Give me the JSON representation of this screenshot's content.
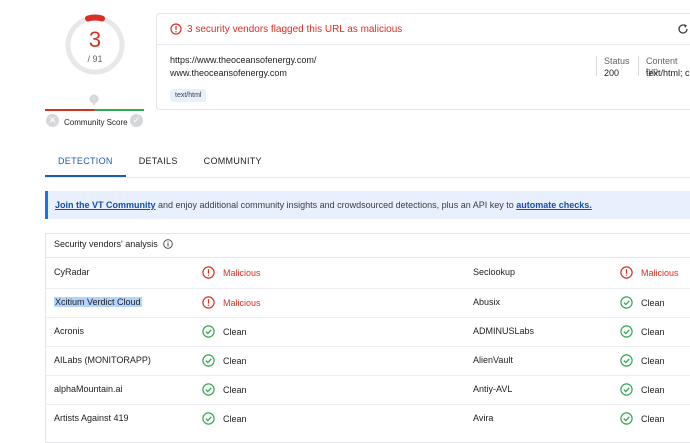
{
  "score": {
    "detections": "3",
    "total": "/ 91",
    "ring_color": "#d93025"
  },
  "community": {
    "label": "Community Score"
  },
  "header": {
    "flag_text": "3 security vendors flagged this URL as malicious",
    "url_full": "https://www.theoceansofenergy.com/",
    "domain": "www.theoceansofenergy.com",
    "status_label": "Status",
    "status_value": "200",
    "content_type_label": "Content typ",
    "content_type_value": "text/html; c",
    "tag": "text/html"
  },
  "tabs": [
    "DETECTION",
    "DETAILS",
    "COMMUNITY"
  ],
  "banner": {
    "link1": "Join the VT Community",
    "middle": " and enjoy additional community insights and crowdsourced detections, plus an API key to ",
    "link2": "automate checks."
  },
  "analysis": {
    "title": "Security vendors' analysis",
    "rows": [
      {
        "left_vendor": "CyRadar",
        "left_result": "Malicious",
        "right_vendor": "Seclookup",
        "right_result": "Malicious"
      },
      {
        "left_vendor": "Xcitium Verdict Cloud",
        "left_result": "Malicious",
        "right_vendor": "Abusix",
        "right_result": "Clean"
      },
      {
        "left_vendor": "Acronis",
        "left_result": "Clean",
        "right_vendor": "ADMINUSLabs",
        "right_result": "Clean"
      },
      {
        "left_vendor": "AILabs (MONITORAPP)",
        "left_result": "Clean",
        "right_vendor": "AlienVault",
        "right_result": "Clean"
      },
      {
        "left_vendor": "alphaMountain.ai",
        "left_result": "Clean",
        "right_vendor": "Antiy-AVL",
        "right_result": "Clean"
      },
      {
        "left_vendor": "Artists Against 419",
        "left_result": "Clean",
        "right_vendor": "Avira",
        "right_result": "Clean"
      }
    ]
  },
  "colors": {
    "malicious": "#d93025",
    "clean": "#34a853",
    "accent": "#1a5cb0"
  }
}
